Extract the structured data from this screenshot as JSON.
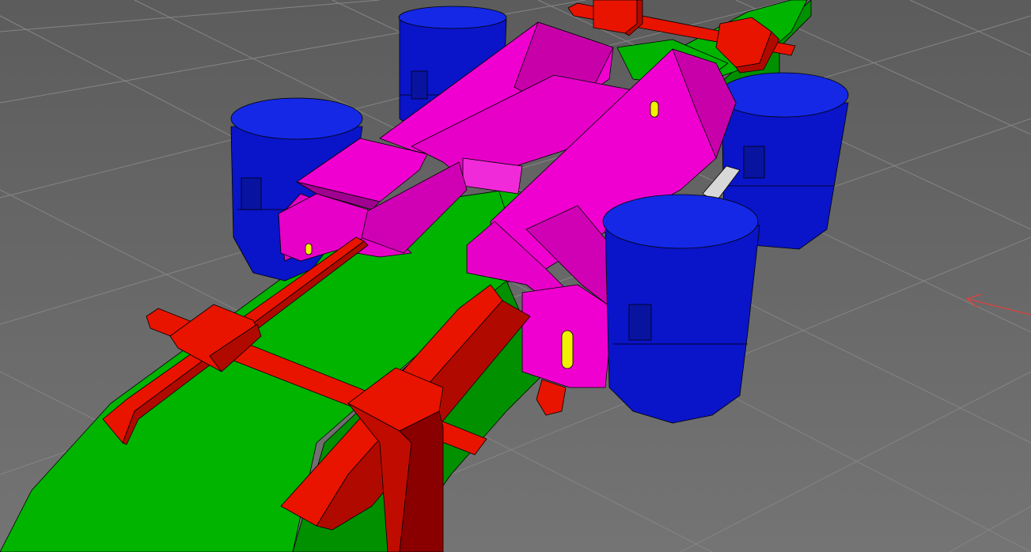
{
  "viewport": {
    "label": "",
    "background_color": "#6a6a6a",
    "grid_color": "#808080",
    "axis_indicator_color": "#e04040",
    "axis_indicator_icon": "arrow-left-icon"
  },
  "model": {
    "parts": [
      {
        "name": "chassis-rail",
        "color": "#00b400"
      },
      {
        "name": "cross-beam",
        "color": "#e81400"
      },
      {
        "name": "body-shell",
        "color": "#e600c8"
      },
      {
        "name": "wheel-front-left",
        "color": "#0a14dc"
      },
      {
        "name": "wheel-front-right",
        "color": "#0a14dc"
      },
      {
        "name": "wheel-rear-left",
        "color": "#0a14dc"
      },
      {
        "name": "wheel-rear-right",
        "color": "#0a14dc"
      },
      {
        "name": "indicator-light",
        "color": "#f0f000"
      },
      {
        "name": "axle-shaft",
        "color": "#d8d8d8"
      }
    ]
  }
}
